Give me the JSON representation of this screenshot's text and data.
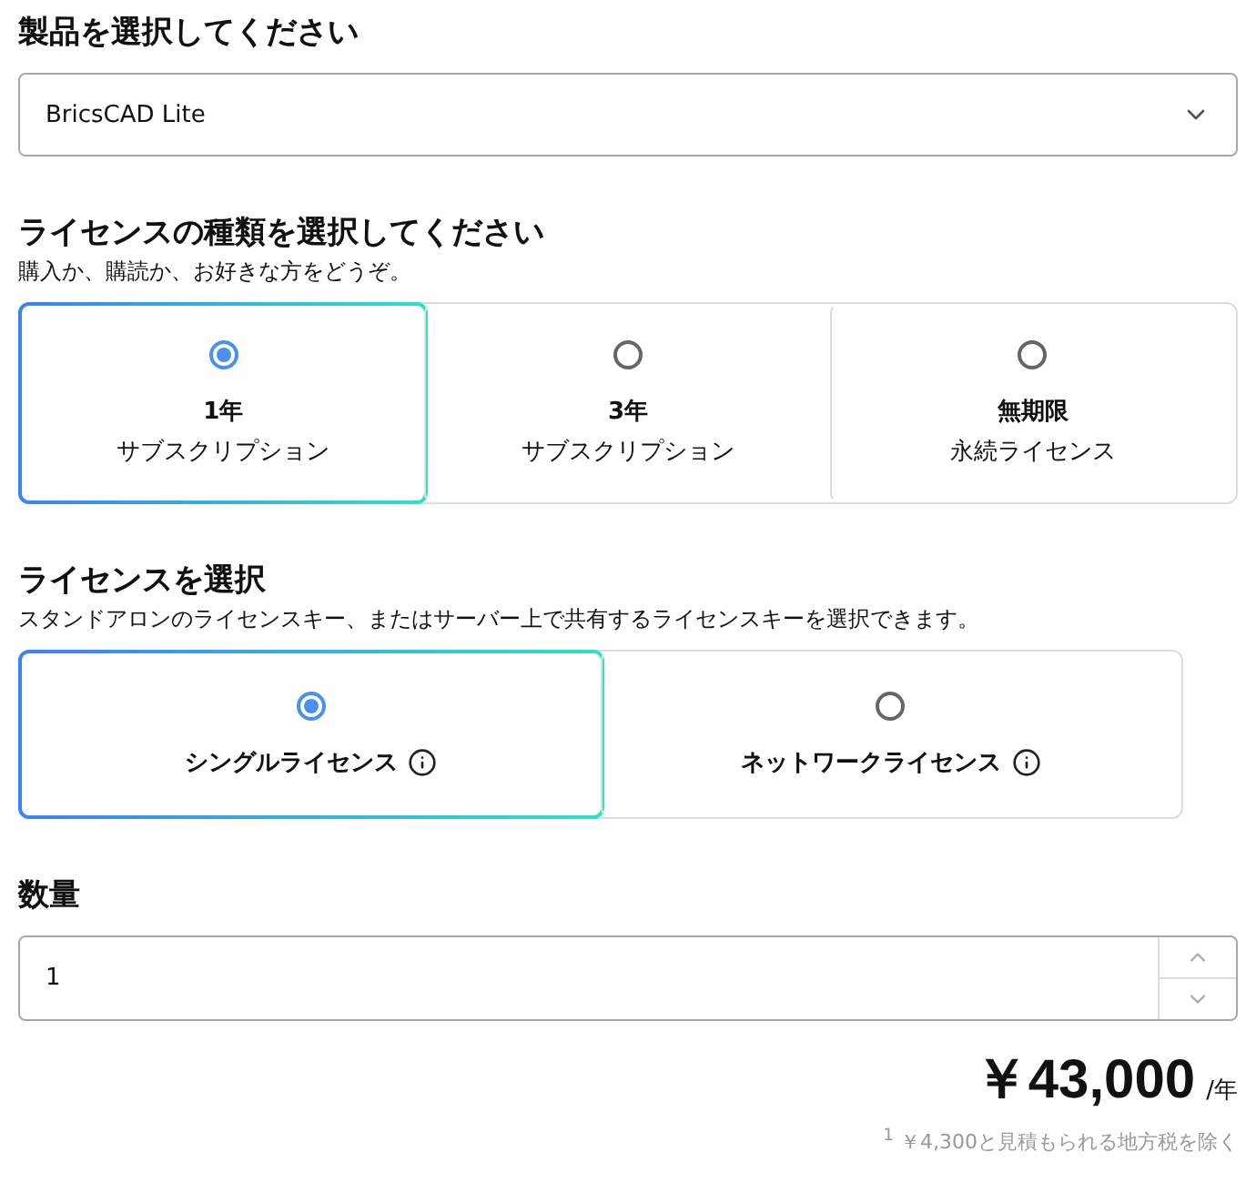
{
  "product": {
    "heading": "製品を選択してください",
    "value": "BricsCAD Lite"
  },
  "license_type": {
    "heading": "ライセンスの種類を選択してください",
    "subtitle": "購入か、購読か、お好きな方をどうぞ。",
    "options": [
      {
        "title": "1年",
        "subtitle": "サブスクリプション",
        "selected": true
      },
      {
        "title": "3年",
        "subtitle": "サブスクリプション",
        "selected": false
      },
      {
        "title": "無期限",
        "subtitle": "永続ライセンス",
        "selected": false
      }
    ]
  },
  "license": {
    "heading": "ライセンスを選択",
    "subtitle": "スタンドアロンのライセンスキー、またはサーバー上で共有するライセンスキーを選択できます。",
    "options": [
      {
        "title": "シングルライセンス",
        "selected": true
      },
      {
        "title": "ネットワークライセンス",
        "selected": false
      }
    ]
  },
  "quantity": {
    "heading": "数量",
    "value": "1"
  },
  "price": {
    "amount": "￥43,000",
    "unit": "/年",
    "footnote": "$^{1}$ ￥4,300と見積もられる地方税を除く"
  }
}
